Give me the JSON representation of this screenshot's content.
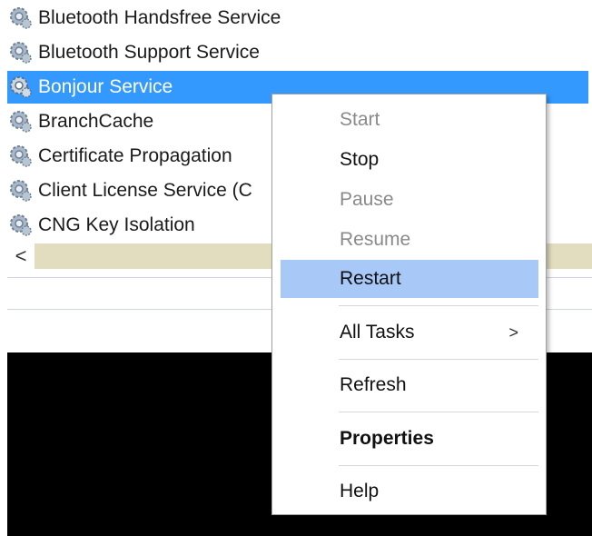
{
  "services": [
    {
      "name": "Bluetooth Handsfree Service",
      "selected": false
    },
    {
      "name": "Bluetooth Support Service",
      "selected": false
    },
    {
      "name": "Bonjour Service",
      "selected": true
    },
    {
      "name": "BranchCache",
      "selected": false
    },
    {
      "name": "Certificate Propagation",
      "selected": false
    },
    {
      "name": "Client License Service (C",
      "selected": false
    },
    {
      "name": "CNG Key Isolation",
      "selected": false
    }
  ],
  "scrollbar": {
    "left_arrow": "<"
  },
  "context_menu": {
    "items": [
      {
        "label": "Start",
        "enabled": false
      },
      {
        "label": "Stop",
        "enabled": true
      },
      {
        "label": "Pause",
        "enabled": false
      },
      {
        "label": "Resume",
        "enabled": false
      },
      {
        "label": "Restart",
        "enabled": true,
        "highlighted": true
      },
      {
        "label": "All Tasks",
        "enabled": true,
        "submenu_arrow": ">"
      },
      {
        "label": "Refresh",
        "enabled": true
      },
      {
        "label": "Properties",
        "enabled": true,
        "bold": true
      },
      {
        "label": "Help",
        "enabled": true
      }
    ]
  },
  "icons": {
    "service": "gear-icon",
    "submenu": "chevron-right-icon",
    "scroll_left": "chevron-left-icon"
  },
  "colors": {
    "selection": "#3399ff",
    "menu_hover": "#a8c8f8",
    "scrollbar_track": "#e2ddbf",
    "disabled_text": "#8a8a8a"
  }
}
